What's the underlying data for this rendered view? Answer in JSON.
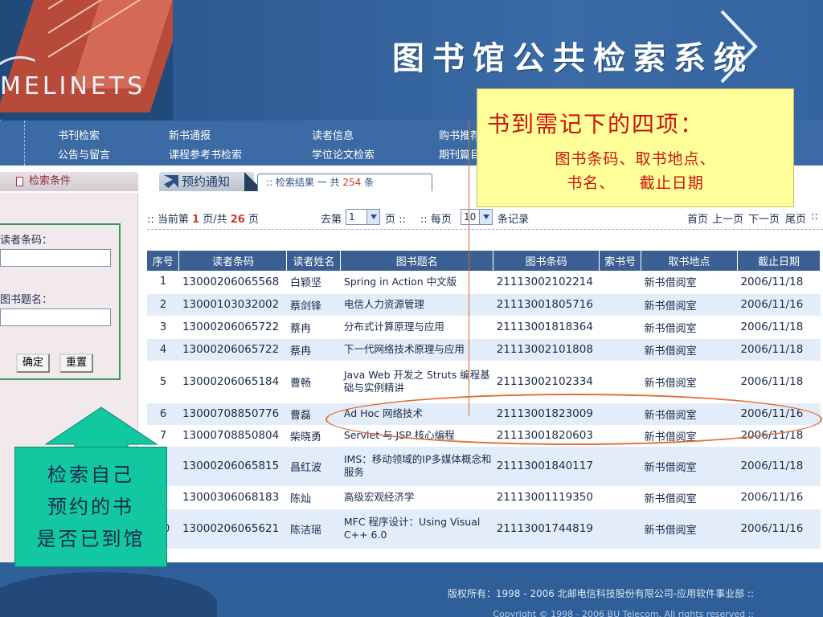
{
  "app": {
    "brand": "MELINETS",
    "title": "图书馆公共检索系统"
  },
  "nav": {
    "row1": [
      "书刊检索",
      "新书通报",
      "读者信息",
      "购书推荐"
    ],
    "row2": [
      "公告与留言",
      "课程参考书检索",
      "学位论文检索",
      "期刊篇目"
    ]
  },
  "tabs": {
    "search_conditions": "检索条件",
    "reservation_notice": "预约通知",
    "results_prefix": ":: 检索结果 一 共 ",
    "results_count": "254",
    "results_suffix": " 条"
  },
  "form": {
    "barcode_label": "读者条码：",
    "barcode_value": "",
    "title_label": "图书题名：",
    "title_value": "",
    "confirm_label": "确定",
    "reset_label": "重置"
  },
  "pager": {
    "current_prefix": ":: 当前第 ",
    "current_page": "1",
    "of_text": " 页/共 ",
    "total_pages": "26",
    "page_unit": " 页",
    "goto_label": "去第",
    "goto_value": "1",
    "goto_unit": "页 ::",
    "per_page_label": ":: 每页",
    "per_page_value": "10",
    "per_page_unit": "条记录",
    "first": "首页",
    "prev": "上一页",
    "next": "下一页",
    "last": "尾页",
    "trail": "::"
  },
  "table": {
    "headers": [
      "序号",
      "读者条码",
      "读者姓名",
      "图书题名",
      "图书条码",
      "索书号",
      "取书地点",
      "截止日期"
    ],
    "rows": [
      {
        "no": "1",
        "reader_barcode": "13000206065568",
        "reader_name": "白颖坚",
        "title": "Spring in Action 中文版",
        "book_barcode": "21113002102214",
        "call_no": "",
        "location": "新书借阅室",
        "due": "2006/11/18"
      },
      {
        "no": "2",
        "reader_barcode": "13000103032002",
        "reader_name": "蔡剑锋",
        "title": "电信人力资源管理",
        "book_barcode": "21113001805716",
        "call_no": "",
        "location": "新书借阅室",
        "due": "2006/11/16"
      },
      {
        "no": "3",
        "reader_barcode": "13000206065722",
        "reader_name": "蔡冉",
        "title": "分布式计算原理与应用",
        "book_barcode": "21113001818364",
        "call_no": "",
        "location": "新书借阅室",
        "due": "2006/11/18"
      },
      {
        "no": "4",
        "reader_barcode": "13000206065722",
        "reader_name": "蔡冉",
        "title": "下一代网络技术原理与应用",
        "book_barcode": "21113002101808",
        "call_no": "",
        "location": "新书借阅室",
        "due": "2006/11/18"
      },
      {
        "no": "5",
        "reader_barcode": "13000206065184",
        "reader_name": "曹畅",
        "title": "Java Web 开发之 Struts 编程基础与实例精讲",
        "book_barcode": "21113002102334",
        "call_no": "",
        "location": "新书借阅室",
        "due": "2006/11/18"
      },
      {
        "no": "6",
        "reader_barcode": "13000708850776",
        "reader_name": "曹磊",
        "title": "Ad Hoc 网络技术",
        "book_barcode": "21113001823009",
        "call_no": "",
        "location": "新书借阅室",
        "due": "2006/11/16"
      },
      {
        "no": "7",
        "reader_barcode": "13000708850804",
        "reader_name": "柴晓勇",
        "title": "Servlet 与 JSP 核心编程",
        "book_barcode": "21113001820603",
        "call_no": "",
        "location": "新书借阅室",
        "due": "2006/11/18"
      },
      {
        "no": "8",
        "reader_barcode": "13000206065815",
        "reader_name": "昌红波",
        "title": "IMS：移动领域的IP多媒体概念和服务",
        "book_barcode": "21113001840117",
        "call_no": "",
        "location": "新书借阅室",
        "due": "2006/11/18"
      },
      {
        "no": "9",
        "reader_barcode": "13000306068183",
        "reader_name": "陈灿",
        "title": "高级宏观经济学",
        "book_barcode": "21113001119350",
        "call_no": "",
        "location": "新书借阅室",
        "due": "2006/11/16"
      },
      {
        "no": "10",
        "reader_barcode": "13000206065621",
        "reader_name": "陈洁瑶",
        "title": "MFC 程序设计：Using Visual C++ 6.0",
        "book_barcode": "21113001744819",
        "call_no": "",
        "location": "新书借阅室",
        "due": "2006/11/16"
      }
    ]
  },
  "footer": {
    "copyright": "版权所有：1998 - 2006 北邮电信科技股份有限公司-应用软件事业部 ::",
    "copyright2": "Copyright © 1998 - 2006 BU Telecom. All rights reserved ::"
  },
  "annotations": {
    "yellow_title": "书到需记下的四项：",
    "yellow_line1": "图书条码、取书地点、",
    "yellow_line2": "书名、　　截止日期",
    "green_line1": "检索自己",
    "green_line2": "预约的书",
    "green_line3": "是否已到馆"
  },
  "colors": {
    "header_blue": "#2f5f98",
    "table_header": "#3b5f92",
    "row_alt": "#e3edf9",
    "callout_yellow": "#ffff99",
    "callout_green": "#12c8a0",
    "annotation_red": "#cc1111"
  }
}
